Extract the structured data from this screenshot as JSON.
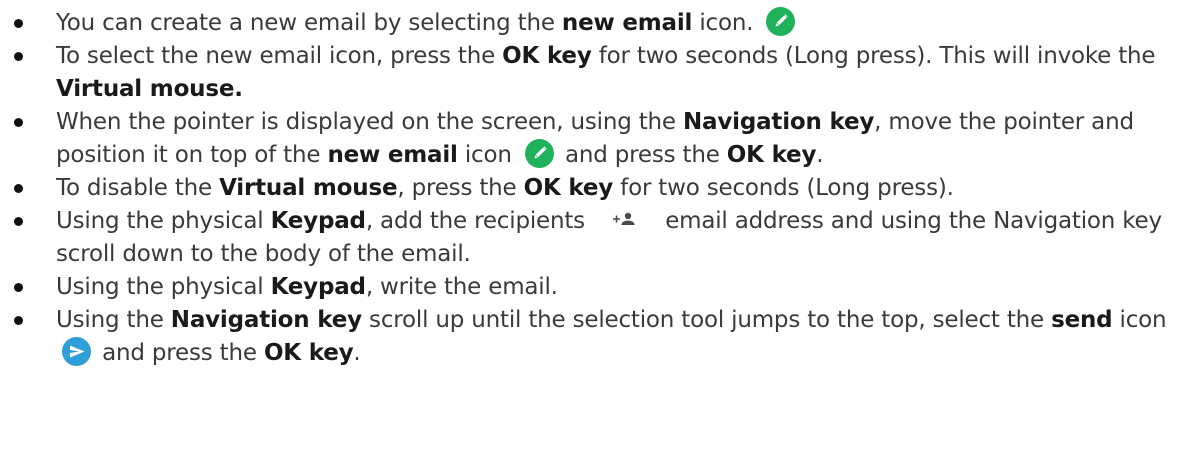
{
  "bullets": [
    {
      "parts": [
        {
          "text": "You can create a new email by selecting the "
        },
        {
          "text": "new email",
          "bold": true
        },
        {
          "text": " icon. "
        },
        {
          "icon": "pencil-icon"
        }
      ]
    },
    {
      "parts": [
        {
          "text": "To select the new email icon, press the "
        },
        {
          "text": "OK key",
          "bold": true
        },
        {
          "text": " for two seconds (Long press). This will invoke the "
        },
        {
          "text": "Virtual mouse.",
          "bold": true
        }
      ]
    },
    {
      "parts": [
        {
          "text": "When the pointer is displayed on the screen, using the "
        },
        {
          "text": "Navigation key",
          "bold": true
        },
        {
          "text": ", move the pointer and position it on top of the "
        },
        {
          "text": "new email",
          "bold": true
        },
        {
          "text": " icon "
        },
        {
          "icon": "pencil-icon"
        },
        {
          "text": " and press the "
        },
        {
          "text": "OK key",
          "bold": true
        },
        {
          "text": "."
        }
      ]
    },
    {
      "parts": [
        {
          "text": "To disable the "
        },
        {
          "text": "Virtual mouse",
          "bold": true
        },
        {
          "text": ", press the "
        },
        {
          "text": "OK key",
          "bold": true
        },
        {
          "text": " for two seconds (Long press)."
        }
      ]
    },
    {
      "parts": [
        {
          "text": "Using the physical "
        },
        {
          "text": "Keypad",
          "bold": true
        },
        {
          "text": ", add the recipients "
        },
        {
          "icon": "add-person-icon"
        },
        {
          "text": " email address and using the Navigation key scroll down to the body of the email."
        }
      ]
    },
    {
      "parts": [
        {
          "text": "Using the physical "
        },
        {
          "text": "Keypad",
          "bold": true
        },
        {
          "text": ", write the email."
        }
      ]
    },
    {
      "parts": [
        {
          "text": "Using the "
        },
        {
          "text": "Navigation key",
          "bold": true
        },
        {
          "text": " scroll up until the selection tool jumps to the top, select the "
        },
        {
          "text": "send",
          "bold": true
        },
        {
          "text": " icon "
        },
        {
          "icon": "send-icon"
        },
        {
          "text": " and press the "
        },
        {
          "text": "OK key",
          "bold": true
        },
        {
          "text": "."
        }
      ]
    }
  ],
  "colors": {
    "pencil_icon_bg": "#1fb25a",
    "send_icon_bg": "#2f9fd8",
    "add_person_icon_fg": "#4a4a4a"
  }
}
